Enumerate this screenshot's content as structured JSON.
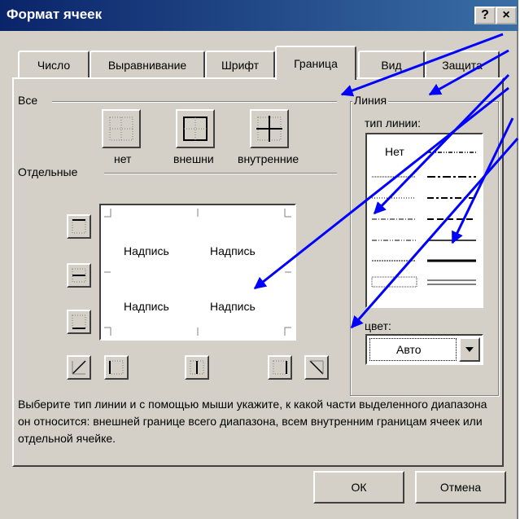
{
  "title": "Формат ячеек",
  "title_buttons": {
    "help": "?",
    "close": "×"
  },
  "tabs": [
    {
      "label": "Число"
    },
    {
      "label": "Выравнивание"
    },
    {
      "label": "Шрифт"
    },
    {
      "label": "Граница"
    },
    {
      "label": "Вид"
    },
    {
      "label": "Защита"
    }
  ],
  "presets": {
    "group_label": "Все",
    "none_label": "нет",
    "outline_label": "внешни",
    "inside_label": "внутренние"
  },
  "border": {
    "group_label": "Отдельные",
    "preview_texts": [
      "Надпись",
      "Надпись",
      "Надпись",
      "Надпись"
    ]
  },
  "line": {
    "group_label": "Линия",
    "style_label": "тип линии:",
    "none_style": "Нет",
    "color_label": "цвет:",
    "color_value": "Авто"
  },
  "description": "Выберите тип линии и с помощью мыши укажите, к какой части выделенного диапазона он относится: внешней границе всего диапазона, всем внутренним границам ячеек или отдельной ячейке.",
  "buttons": {
    "ok": "ОК",
    "cancel": "Отмена"
  },
  "colors": {
    "titlebar_start": "#0a246a",
    "titlebar_end": "#3a6ea5",
    "face": "#d4d0c8",
    "arrow": "#0000ff"
  }
}
